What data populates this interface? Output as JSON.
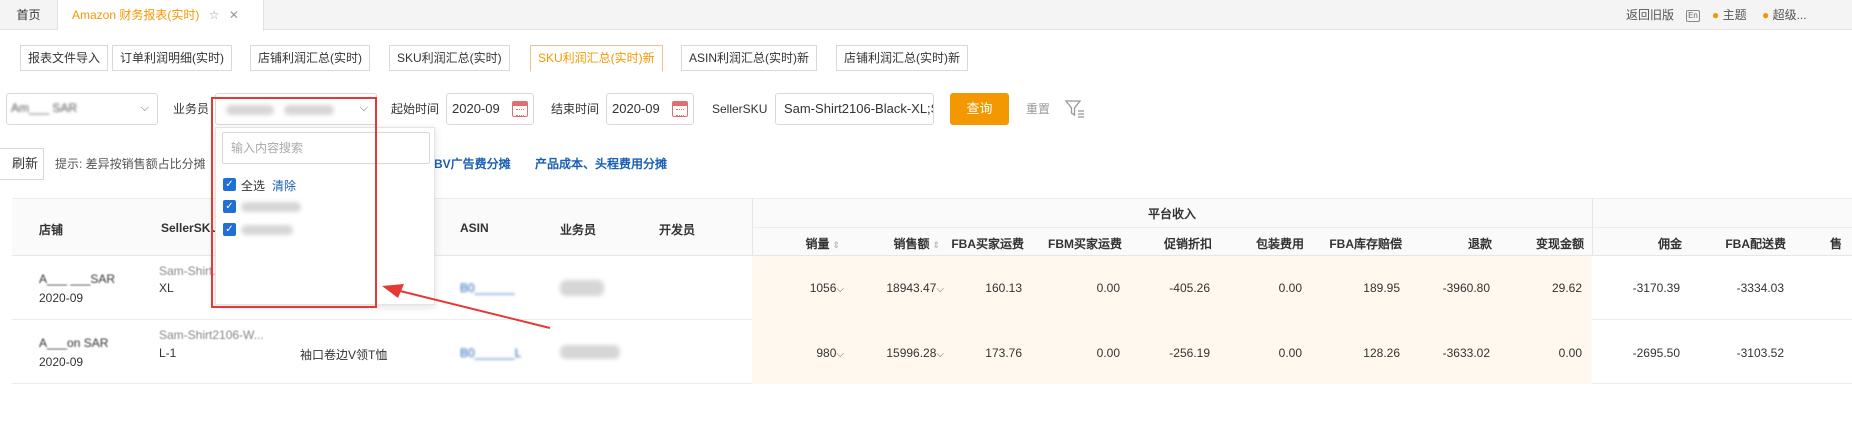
{
  "topbar": {
    "home_tab": "首页",
    "active_tab": "Amazon 财务报表(实时)",
    "star_icon": "☆",
    "close_icon": "✕",
    "legacy_link": "返回旧版",
    "lang_badge": "En",
    "theme_label": "主题",
    "user_label": "超级..."
  },
  "subtabs": [
    {
      "label": "报表文件导入"
    },
    {
      "label": "订单利润明细(实时)"
    },
    {
      "label": "店铺利润汇总(实时)"
    },
    {
      "label": "SKU利润汇总(实时)"
    },
    {
      "label": "SKU利润汇总(实时)新"
    },
    {
      "label": "ASIN利润汇总(实时)新"
    },
    {
      "label": "店铺利润汇总(实时)新"
    }
  ],
  "filters": {
    "shop_value": "Am___ SAR",
    "salesperson_label": "业务员",
    "start_label": "起始时间",
    "start_value": "2020-09",
    "end_label": "结束时间",
    "end_value": "2020-09",
    "sku_label": "SellerSKU",
    "sku_value": "Sam-Shirt2106-Black-XL;S",
    "query_button": "查询",
    "reset_button": "重置"
  },
  "toolbar": {
    "refresh": "刷新",
    "tip": "提示: 差异按销售额占比分摊",
    "link_ads": "BV广告费分摊",
    "link_cost": "产品成本、头程费用分摊"
  },
  "dropdown": {
    "search_placeholder": "输入内容搜索",
    "select_all": "全选",
    "clear": "清除"
  },
  "table": {
    "group_header": "平台收入",
    "columns": {
      "shop": "店铺",
      "sku": "SellerSKU",
      "asin": "ASIN",
      "salesperson": "业务员",
      "developer": "开发员",
      "qty": "销量",
      "sales": "销售额",
      "fba_buyer_ship": "FBA买家运费",
      "fbm_buyer_ship": "FBM买家运费",
      "promo": "促销折扣",
      "packaging": "包装费用",
      "fba_inv_comp": "FBA库存赔偿",
      "refund": "退款",
      "cash_amount": "变现金额",
      "commission": "佣金",
      "fba_delivery": "FBA配送费",
      "extra": "售"
    },
    "rows": [
      {
        "shop": "A___ ___SAR",
        "month": "2020-09",
        "sku1": "Sam-Shirt...",
        "sku2": "XL",
        "title": "",
        "asin": "B0______",
        "sp": "___",
        "qty": "1056",
        "sales": "18943.47",
        "fba_buyer_ship": "160.13",
        "fbm_buyer_ship": "0.00",
        "promo": "-405.26",
        "packaging": "0.00",
        "fba_inv_comp": "189.95",
        "refund": "-3960.80",
        "cash_amount": "29.62",
        "commission": "-3170.39",
        "fba_delivery": "-3334.03"
      },
      {
        "shop": "A___on SAR",
        "month": "2020-09",
        "sku1": "Sam-Shirt2106-W...",
        "sku2": "L-1",
        "title": "袖口卷边V领T恤",
        "asin": "B0______L",
        "sp": "___",
        "qty": "980",
        "sales": "15996.28",
        "fba_buyer_ship": "173.76",
        "fbm_buyer_ship": "0.00",
        "promo": "-256.19",
        "packaging": "0.00",
        "fba_inv_comp": "128.26",
        "refund": "-3633.02",
        "cash_amount": "0.00",
        "commission": "-2695.50",
        "fba_delivery": "-3103.52"
      }
    ]
  },
  "colors": {
    "accent": "#f39800",
    "link": "#1a5fb4",
    "checkbox": "#1f6fd6",
    "annotation": "#e53935"
  }
}
